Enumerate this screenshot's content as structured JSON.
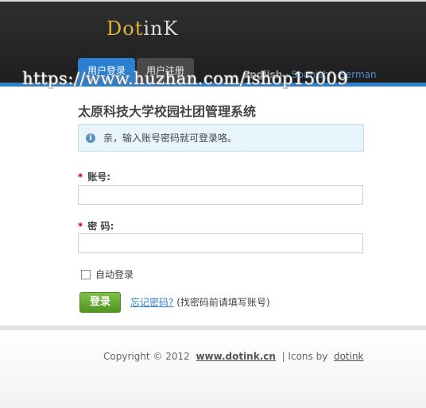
{
  "header": {
    "logo_part1": "Dot",
    "logo_part2": "inK",
    "tabs": [
      {
        "label": "用户登录",
        "active": true
      },
      {
        "label": "用户注册",
        "active": false
      }
    ],
    "languages": {
      "english": "English",
      "sep1": "·",
      "spanish": "Spanish",
      "sep2": "·",
      "german": "German"
    },
    "watermark": "https://www.huzhan.com/ishop15009"
  },
  "main": {
    "title": "太原科技大学校园社团管理系统",
    "info_message": "亲，输入账号密码就可登录咯。",
    "info_icon": "info-icon",
    "account_label": "账号:",
    "account_value": "",
    "password_label": "密 码:",
    "password_value": "",
    "required_mark": "*",
    "auto_login_label": "自动登录",
    "auto_login_checked": false,
    "login_button": "登录",
    "forgot_link": "忘记密码?",
    "forgot_hint": "(找密码前请填写账号)"
  },
  "footer": {
    "copyright": "Copyright © 2012",
    "site": "www.dotink.cn",
    "icons_by": "| Icons by",
    "brand": "dotink"
  },
  "colors": {
    "header_bg": "#262626",
    "accent_blue": "#2d7fd0",
    "logo_gold": "#e2b43c",
    "button_green": "#5fa62c",
    "required_red": "#cc0000"
  }
}
